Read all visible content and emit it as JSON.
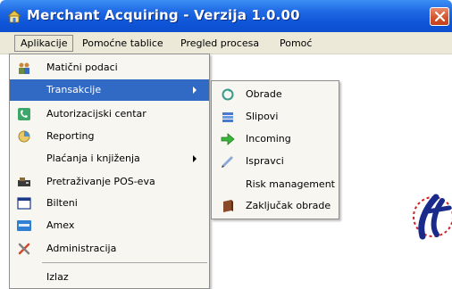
{
  "window": {
    "title": "Merchant Acquiring - Verzija 1.0.00"
  },
  "menubar": {
    "items": [
      {
        "label": "Aplikacije"
      },
      {
        "label": "Pomoćne tablice"
      },
      {
        "label": "Pregled procesa"
      },
      {
        "label": "Pomoć"
      }
    ]
  },
  "aplikacije_menu": {
    "items": [
      {
        "label": "Matični podaci",
        "icon": "people-icon"
      },
      {
        "label": "Transakcije",
        "icon": "none",
        "submenu": true,
        "highlighted": true
      },
      {
        "label": "Autorizacijski centar",
        "icon": "phone-icon"
      },
      {
        "label": "Reporting",
        "icon": "report-icon"
      },
      {
        "label": "Plaćanja i knjiženja",
        "icon": "none",
        "submenu": true
      },
      {
        "label": "Pretraživanje POS-eva",
        "icon": "pos-terminal-icon"
      },
      {
        "label": "Bilteni",
        "icon": "window-icon"
      },
      {
        "label": "Amex",
        "icon": "amex-card-icon"
      },
      {
        "label": "Administracija",
        "icon": "tools-icon"
      },
      {
        "label": "Izlaz",
        "icon": "none"
      }
    ]
  },
  "transakcije_submenu": {
    "items": [
      {
        "label": "Obrade",
        "icon": "process-icon"
      },
      {
        "label": "Slipovi",
        "icon": "slips-icon"
      },
      {
        "label": "Incoming",
        "icon": "green-arrow-icon"
      },
      {
        "label": "Ispravci",
        "icon": "correction-icon"
      },
      {
        "label": "Risk management",
        "icon": "none"
      },
      {
        "label": "Zaključak obrade",
        "icon": "book-icon"
      }
    ]
  },
  "colors": {
    "titlebar": "#0f55d8",
    "highlight": "#316ac5",
    "close_button": "#d4522b",
    "logo": "#1a2a8a",
    "logo_accent": "#d0202a"
  }
}
